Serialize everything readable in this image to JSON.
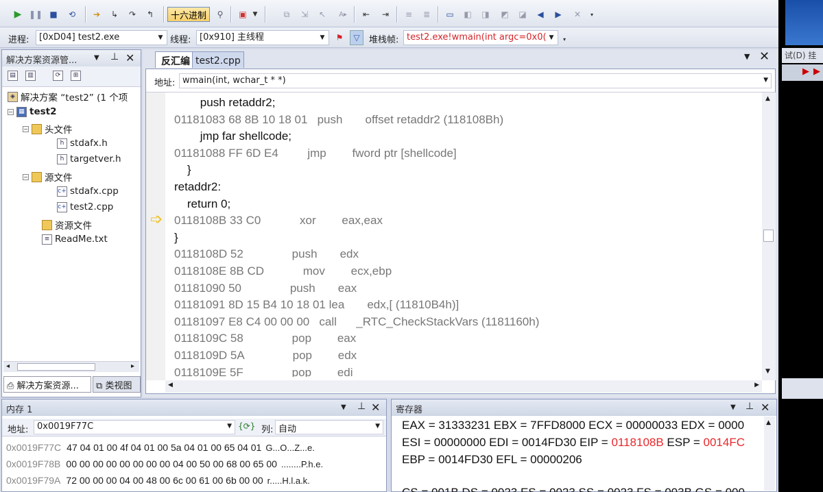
{
  "toolbar": {
    "hex_label": "十六进制"
  },
  "debug_bar": {
    "process_label": "进程:",
    "process_value": "[0xD04] test2.exe",
    "thread_label": "线程:",
    "thread_value": "[0x910] 主线程",
    "stack_label": "堆栈帧:",
    "stack_value": "test2.exe!wmain(int argc=0x0("
  },
  "solution_explorer": {
    "title": "解决方案资源管...",
    "tree": [
      {
        "label": "解决方案 “test2” (1 个项",
        "icon": "solution-icon"
      },
      {
        "label": "test2",
        "icon": "project-icon"
      },
      {
        "label": "头文件",
        "icon": "folder-icon"
      },
      {
        "label": "stdafx.h",
        "icon": "header-file-icon"
      },
      {
        "label": "targetver.h",
        "icon": "header-file-icon"
      },
      {
        "label": "源文件",
        "icon": "folder-icon"
      },
      {
        "label": "stdafx.cpp",
        "icon": "cpp-file-icon"
      },
      {
        "label": "test2.cpp",
        "icon": "cpp-file-icon"
      },
      {
        "label": "资源文件",
        "icon": "folder-icon"
      },
      {
        "label": "ReadMe.txt",
        "icon": "text-file-icon"
      }
    ],
    "bottom_tabs": [
      "解决方案资源...",
      "类视图"
    ]
  },
  "editor": {
    "tabs": [
      "反汇编",
      "test2.cpp"
    ],
    "address_label": "地址:",
    "address_value": "wmain(int, wchar_t * *)",
    "lines": [
      {
        "text": "        push retaddr2;",
        "kind": "src"
      },
      {
        "text": "01181083 68 8B 10 18 01   push       offset retaddr2 (118108Bh)",
        "kind": "asm"
      },
      {
        "text": "        jmp far shellcode;",
        "kind": "src"
      },
      {
        "text": "01181088 FF 6D E4         jmp        fword ptr [shellcode]",
        "kind": "asm"
      },
      {
        "text": "    }",
        "kind": "src"
      },
      {
        "text": "retaddr2:",
        "kind": "src"
      },
      {
        "text": "    return 0;",
        "kind": "src"
      },
      {
        "text": "0118108B 33 C0            xor        eax,eax",
        "kind": "asm"
      },
      {
        "text": "}",
        "kind": "src"
      },
      {
        "text": "0118108D 52               push       edx",
        "kind": "asm"
      },
      {
        "text": "0118108E 8B CD            mov        ecx,ebp",
        "kind": "asm"
      },
      {
        "text": "01181090 50               push       eax",
        "kind": "asm"
      },
      {
        "text": "01181091 8D 15 B4 10 18 01 lea       edx,[ (11810B4h)]",
        "kind": "asm"
      },
      {
        "text": "01181097 E8 C4 00 00 00   call      _RTC_CheckStackVars (1181160h)",
        "kind": "asm"
      },
      {
        "text": "0118109C 58               pop        eax",
        "kind": "asm"
      },
      {
        "text": "0118109D 5A               pop        edx",
        "kind": "asm"
      },
      {
        "text": "0118109E 5F               pop        edi",
        "kind": "asm"
      }
    ]
  },
  "memory": {
    "title": "内存 1",
    "address_label": "地址:",
    "address_value": "0x0019F77C",
    "columns_label": "列:",
    "columns_value": "自动",
    "rows": [
      {
        "addr": "0x0019F77C",
        "bytes": "47 04 01 00 4f 04 01 00 5a 04 01 00 65 04 01",
        "ascii": "G...O...Z...e."
      },
      {
        "addr": "0x0019F78B",
        "bytes": "00 00 00 00 00 00 00 00 04 00 50 00 68 00 65 00",
        "ascii": "........P.h.e."
      },
      {
        "addr": "0x0019F79A",
        "bytes": "72 00 00 00 04 00 48 00 6c 00 61 00 6b 00 00",
        "ascii": "r.....H.l.a.k."
      }
    ]
  },
  "registers": {
    "title": "寄存器",
    "line1": "EAX = 31333231 EBX = 7FFD8000 ECX = 00000033 EDX = 0000",
    "line2_a": "ESI = 00000000 EDI = 0014FD30 EIP = ",
    "line2_eip": "0118108B",
    "line2_b": " ESP = ",
    "line2_esp": "0014FC",
    "line3": "EBP = 0014FD30 EFL = 00000206",
    "line4": "CS = 001B DS = 0023 ES = 0023 SS = 0023 FS = 003B GS = 000"
  },
  "right_strip": {
    "menu_text": "试(D)  挂"
  },
  "colors": {
    "changed_register": "#e8282b",
    "stack_value": "#d4242a"
  }
}
